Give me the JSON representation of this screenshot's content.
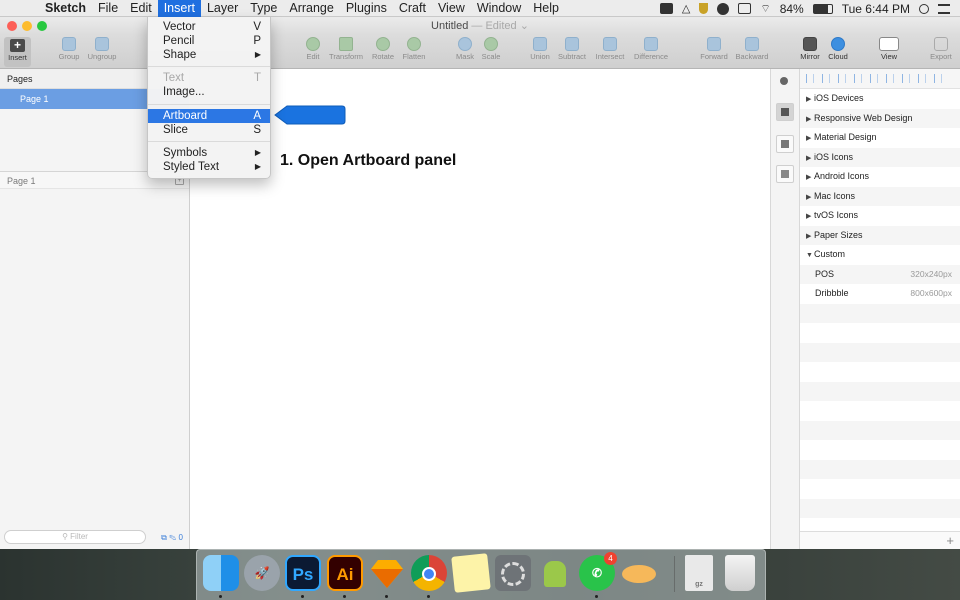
{
  "menubar": {
    "app_name": "Sketch",
    "items": [
      "File",
      "Edit",
      "Insert",
      "Layer",
      "Type",
      "Arrange",
      "Plugins",
      "Craft",
      "View",
      "Window",
      "Help"
    ],
    "active_item": "Insert",
    "battery": "84%",
    "clock": "Tue 6:44 PM"
  },
  "window": {
    "title": "Untitled",
    "title_suffix": "— Edited"
  },
  "toolbar": {
    "insert": "Insert",
    "group": "Group",
    "ungroup": "Ungroup",
    "edit": "Edit",
    "transform": "Transform",
    "rotate": "Rotate",
    "flatten": "Flatten",
    "mask": "Mask",
    "scale": "Scale",
    "union": "Union",
    "subtract": "Subtract",
    "intersect": "Intersect",
    "difference": "Difference",
    "forward": "Forward",
    "backward": "Backward",
    "mirror": "Mirror",
    "cloud": "Cloud",
    "view": "View",
    "export": "Export"
  },
  "insert_menu": {
    "items": [
      {
        "label": "Vector",
        "shortcut": "V"
      },
      {
        "label": "Pencil",
        "shortcut": "P"
      },
      {
        "label": "Shape",
        "shortcut": "▶"
      },
      {
        "label": "Text",
        "shortcut": "T"
      },
      {
        "label": "Image...",
        "shortcut": ""
      },
      {
        "label": "Artboard",
        "shortcut": "A"
      },
      {
        "label": "Slice",
        "shortcut": "S"
      },
      {
        "label": "Symbols",
        "shortcut": "▶"
      },
      {
        "label": "Styled Text",
        "shortcut": "▶"
      }
    ],
    "highlighted": "Artboard",
    "disabled": "Text"
  },
  "left_panel": {
    "pages_header": "Pages",
    "page_item": "Page 1",
    "layers_header": "Page 1",
    "filter_placeholder": "Filter",
    "filter_count": "0"
  },
  "canvas": {
    "instruction": "1. Open Artboard panel"
  },
  "right_panel": {
    "groups": [
      {
        "label": "iOS Devices",
        "expanded": false
      },
      {
        "label": "Responsive Web Design",
        "expanded": false
      },
      {
        "label": "Material Design",
        "expanded": false
      },
      {
        "label": "iOS Icons",
        "expanded": false
      },
      {
        "label": "Android Icons",
        "expanded": false
      },
      {
        "label": "Mac Icons",
        "expanded": false
      },
      {
        "label": "tvOS Icons",
        "expanded": false
      },
      {
        "label": "Paper Sizes",
        "expanded": false
      },
      {
        "label": "Custom",
        "expanded": true
      }
    ],
    "custom_presets": [
      {
        "label": "POS",
        "size": "320x240px"
      },
      {
        "label": "Dribbble",
        "size": "800x600px"
      }
    ],
    "add_symbol": "+"
  },
  "dock": {
    "apps": [
      "finder-icon",
      "launchpad-icon",
      "photoshop-icon",
      "illustrator-icon",
      "sketch-icon",
      "chrome-icon",
      "notes-icon",
      "system-preferences-icon",
      "android-file-transfer-icon",
      "whatsapp-icon",
      "zeplin-icon",
      "downloads-icon",
      "trash-icon"
    ],
    "photoshop_label": "Ps",
    "illustrator_label": "Ai",
    "whatsapp_badge": "4",
    "downloads_label": "gz"
  },
  "colors": {
    "accent": "#2c77e4",
    "selection": "#6b9ee3",
    "callout": "#1a73e0"
  }
}
